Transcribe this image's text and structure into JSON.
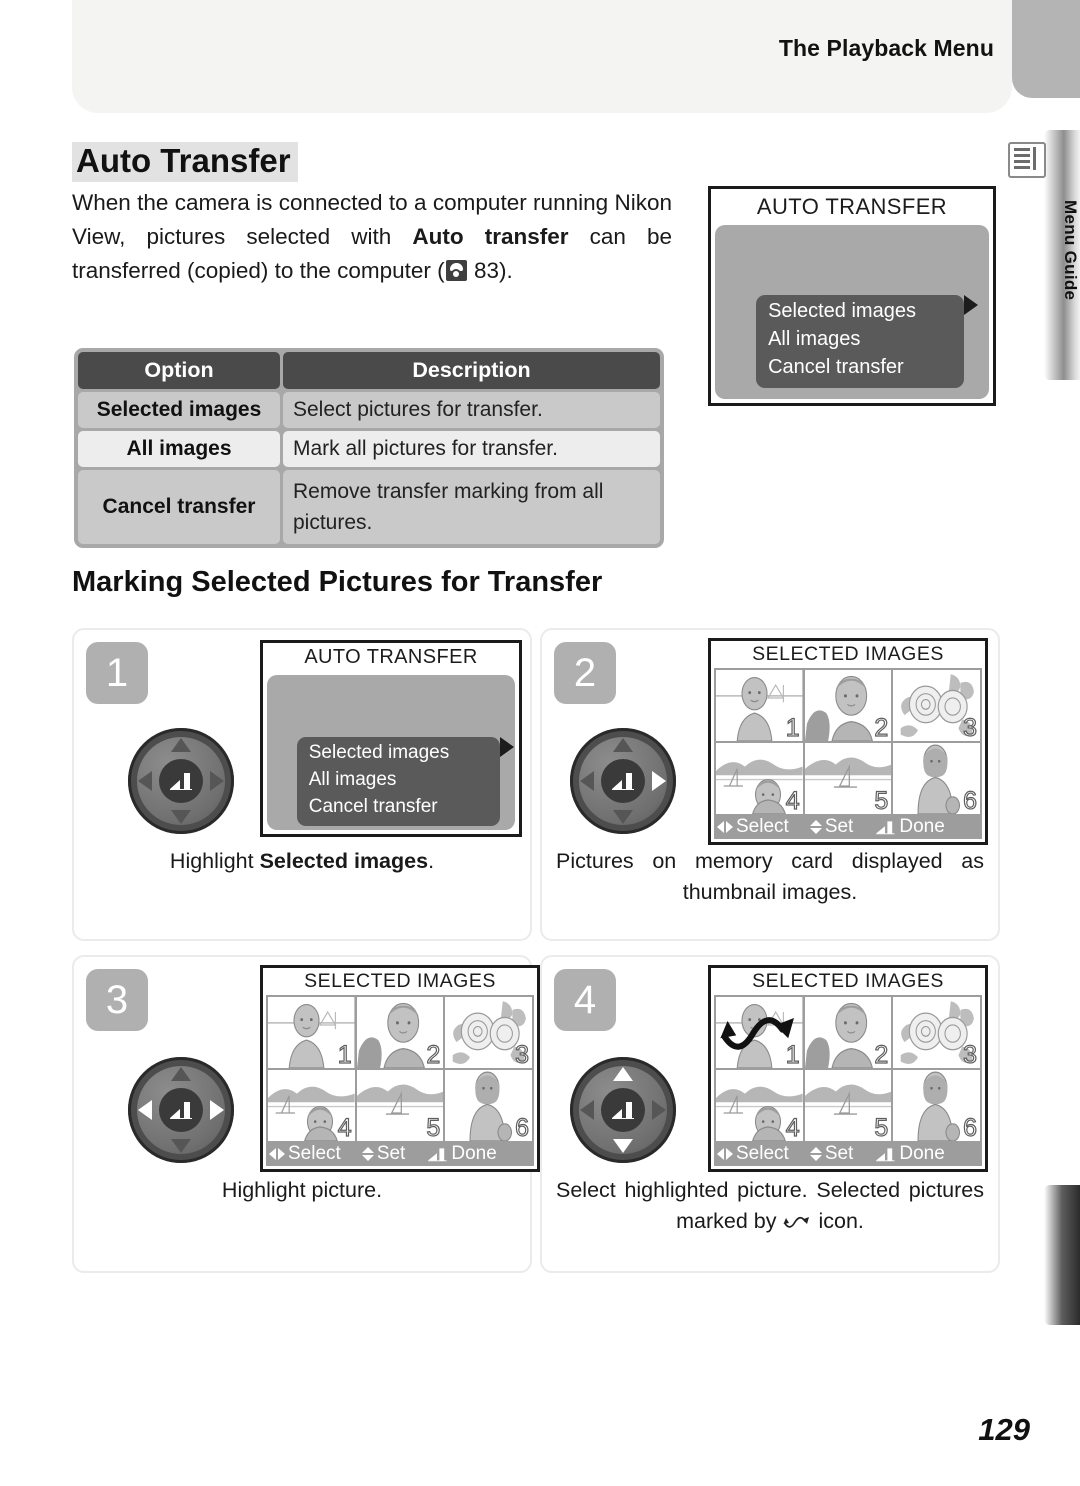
{
  "header": {
    "title": "The Playback Menu",
    "side_tab_label": "Menu Guide",
    "side_tab_icon": "menu-list-icon"
  },
  "section": {
    "heading": "Auto Transfer",
    "intro_part1": "When the camera is connected to a computer running Nikon View, pictures selected with ",
    "intro_bold1": "Auto transfer",
    "intro_part2": " can be transferred (copied) to the computer (",
    "intro_ref_page": "83",
    "intro_part3": ")."
  },
  "options_table": {
    "headers": [
      "Option",
      "Description"
    ],
    "rows": [
      {
        "option": "Selected images",
        "description": "Select pictures for transfer."
      },
      {
        "option": "All images",
        "description": "Mark all pictures for transfer."
      },
      {
        "option": "Cancel transfer",
        "description": "Remove  transfer marking from all pictures."
      }
    ]
  },
  "top_screen": {
    "title": "AUTO TRANSFER",
    "items": [
      "Selected images",
      "All images",
      "Cancel transfer"
    ],
    "selected_index": 0,
    "caret": "right-caret-icon"
  },
  "procedure": {
    "heading": "Marking Selected Pictures for Transfer",
    "steps": [
      {
        "number": "1",
        "screen_title": "AUTO TRANSFER",
        "menu_items": [
          "Selected images",
          "All images",
          "Cancel transfer"
        ],
        "caption_pre": "Highlight ",
        "caption_bold": "Selected images",
        "caption_post": ".",
        "dpad_active": []
      },
      {
        "number": "2",
        "screen_title": "SELECTED IMAGES",
        "caption": "Pictures on memory card displayed as thumbnail images.",
        "dpad_active": [
          "right"
        ],
        "thumbnails": [
          "1",
          "2",
          "3",
          "4",
          "5",
          "6"
        ],
        "highlighted_thumb": 1,
        "marked_thumbs": [],
        "hint_bar": [
          {
            "icon": "left-right-arrows-icon",
            "label": "Select"
          },
          {
            "icon": "up-down-arrows-icon",
            "label": "Set"
          },
          {
            "icon": "enter-arrow-icon",
            "label": "Done"
          }
        ]
      },
      {
        "number": "3",
        "screen_title": "SELECTED IMAGES",
        "caption": "Highlight picture.",
        "dpad_active": [
          "left",
          "right"
        ],
        "thumbnails": [
          "1",
          "2",
          "3",
          "4",
          "5",
          "6"
        ],
        "highlighted_thumb": 1,
        "marked_thumbs": [],
        "hint_bar": [
          {
            "icon": "left-right-arrows-icon",
            "label": "Select"
          },
          {
            "icon": "up-down-arrows-icon",
            "label": "Set"
          },
          {
            "icon": "enter-arrow-icon",
            "label": "Done"
          }
        ]
      },
      {
        "number": "4",
        "screen_title": "SELECTED IMAGES",
        "caption_pre": "Select highlighted picture.  Selected pictures marked by ",
        "caption_icon": "transfer-mark-icon",
        "caption_post": " icon.",
        "dpad_active": [
          "up",
          "down"
        ],
        "thumbnails": [
          "1",
          "2",
          "3",
          "4",
          "5",
          "6"
        ],
        "highlighted_thumb": 1,
        "marked_thumbs": [
          1
        ],
        "hint_bar": [
          {
            "icon": "left-right-arrows-icon",
            "label": "Select"
          },
          {
            "icon": "up-down-arrows-icon",
            "label": "Set"
          },
          {
            "icon": "enter-arrow-icon",
            "label": "Done"
          }
        ]
      }
    ]
  },
  "footer": {
    "page_number": "129"
  },
  "colors": {
    "header_band": "#f4f4f2",
    "table_header": "#4a4a4a",
    "table_row_a": "#c9c9c9",
    "table_row_b": "#ededed",
    "lcd_background": "#a9a9a9",
    "menu_block": "#5a5a5a",
    "step_badge": "#b0b0b0"
  }
}
